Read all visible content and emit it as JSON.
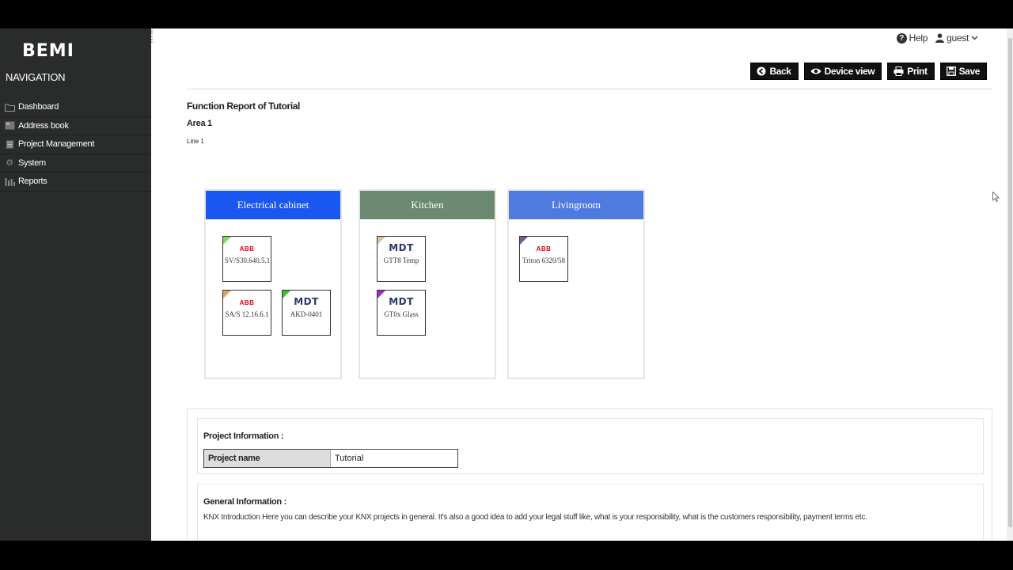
{
  "sidebar": {
    "logo": "BEMI",
    "nav_title": "NAVIGATION",
    "items": [
      {
        "label": "Dashboard",
        "icon": "folder-icon"
      },
      {
        "label": "Address book",
        "icon": "address-book-icon"
      },
      {
        "label": "Project Management",
        "icon": "list-icon"
      },
      {
        "label": "System",
        "icon": "gear-icon"
      },
      {
        "label": "Reports",
        "icon": "bar-chart-icon"
      }
    ]
  },
  "topbar": {
    "help_label": "Help",
    "user_label": "guest"
  },
  "toolbar": {
    "back_label": "Back",
    "device_view_label": "Device view",
    "print_label": "Print",
    "save_label": "Save"
  },
  "report": {
    "title": "Function Report of Tutorial",
    "area": "Area 1",
    "line": "Line 1"
  },
  "rooms": [
    {
      "name": "Electrical cabinet",
      "color": "#1a56f0",
      "devices": [
        {
          "brand": "ABB",
          "name": "SV/S30.640.5.1",
          "corner": "#7ed957"
        },
        {
          "brand": "ABB",
          "name": "SA/S 12.16.6.1",
          "corner": "#e0a36a"
        },
        {
          "brand": "MDT",
          "name": "AKD-0401",
          "corner": "#2ec82e"
        }
      ]
    },
    {
      "name": "Kitchen",
      "color": "#6c8a72",
      "devices": [
        {
          "brand": "MDT",
          "name": "GTT8 Temp",
          "corner": "#d9c6a8"
        },
        {
          "brand": "MDT",
          "name": "GT0x Glass",
          "corner": "#9b30c8"
        }
      ]
    },
    {
      "name": "Livingroom",
      "color": "#4f7ae0",
      "devices": [
        {
          "brand": "ABB",
          "name": "Triton 6320/58",
          "corner": "#7a5a98"
        }
      ]
    }
  ],
  "project_info": {
    "heading": "Project Information :",
    "key": "Project name",
    "value": "Tutorial"
  },
  "general_info": {
    "heading": "General Information :",
    "text": "KNX Introduction Here you can describe your KNX projects in general. It's also a good idea to add your legal stuff like, what is your responsibility, what is the customers responsibility, payment terms etc."
  }
}
